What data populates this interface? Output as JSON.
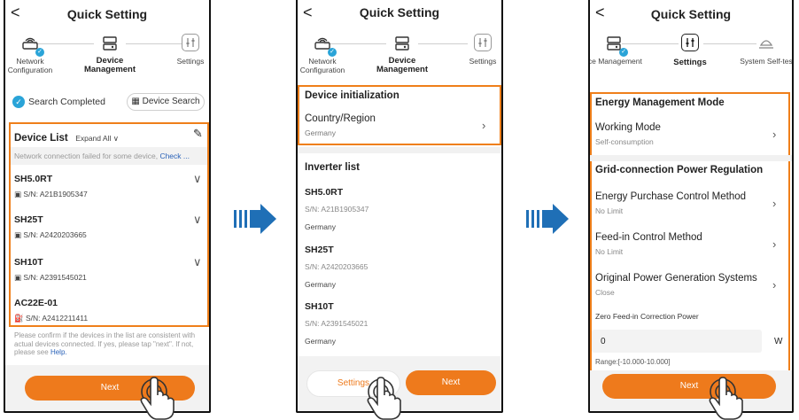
{
  "p1": {
    "title": "Quick Setting",
    "back": "<",
    "steps": [
      "Network Configuration",
      "Device Management",
      "Settings"
    ],
    "search_completed": "Search Completed",
    "device_search": "Device Search",
    "device_list": "Device List",
    "expand_all": "Expand All",
    "warning": "Network connection failed for some device,",
    "warning_link": "Check ...",
    "devices": [
      {
        "name": "SH5.0RT",
        "sn": "S/N: A21B1905347"
      },
      {
        "name": "SH25T",
        "sn": "S/N: A2420203665"
      },
      {
        "name": "SH10T",
        "sn": "S/N: A2391545021"
      },
      {
        "name": "AC22E-01",
        "sn": "S/N: A2412211411"
      }
    ],
    "confirm_text": "Please confirm if the devices in the list are consistent with actual devices connected. If yes, please tap \"next\". If not, please see",
    "help_link": "Help.",
    "next": "Next"
  },
  "p2": {
    "title": "Quick Setting",
    "back": "<",
    "steps": [
      "Network Configuration",
      "Device Management",
      "Settings"
    ],
    "device_init": "Device initialization",
    "country_label": "Country/Region",
    "country_value": "Germany",
    "inverter_list": "Inverter list",
    "inverters": [
      {
        "name": "SH5.0RT",
        "sn": "S/N: A21B1905347",
        "country": "Germany"
      },
      {
        "name": "SH25T",
        "sn": "S/N: A2420203665",
        "country": "Germany"
      },
      {
        "name": "SH10T",
        "sn": "S/N: A2391545021",
        "country": "Germany"
      }
    ],
    "settings_btn": "Settings",
    "next": "Next"
  },
  "p3": {
    "title": "Quick Setting",
    "back": "<",
    "steps": [
      "ice Management",
      "Settings",
      "System Self-tes"
    ],
    "energy_mode": "Energy Management Mode",
    "working_mode": "Working Mode",
    "working_value": "Self-consumption",
    "grid_reg": "Grid-connection Power Regulation",
    "purchase_label": "Energy Purchase Control Method",
    "purchase_value": "No Limit",
    "feedin_label": "Feed-in Control Method",
    "feedin_value": "No Limit",
    "original_label": "Original Power Generation Systems",
    "original_value": "Close",
    "zero_label": "Zero Feed-in Correction Power",
    "zero_value": "0",
    "zero_unit": "W",
    "range": "Range:[-10.000-10.000]",
    "next": "Next"
  },
  "colors": {
    "accent": "#ee7a1c",
    "arrow": "#1f6fb6",
    "check": "#2aa4d8",
    "link": "#2a62b8"
  }
}
